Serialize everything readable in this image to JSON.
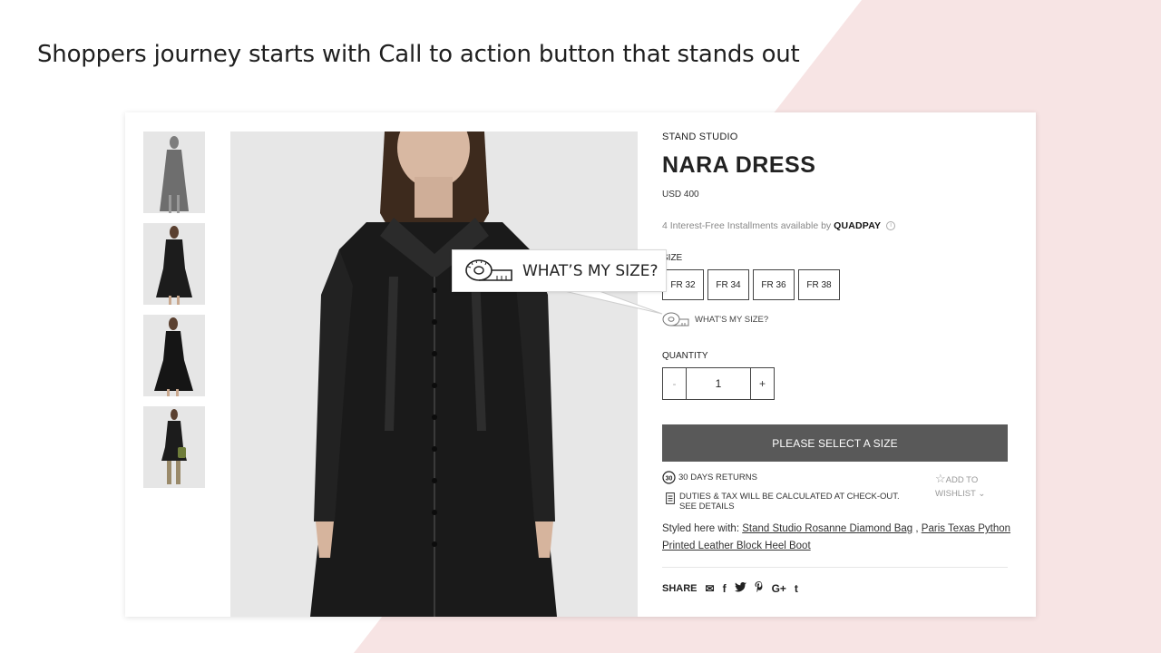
{
  "slide": {
    "title": "Shoppers journey starts with Call to action button that stands out",
    "accent_color": "#f7e4e4"
  },
  "product": {
    "brand": "STAND STUDIO",
    "name": "NARA DRESS",
    "price": "USD 400",
    "installments_text": "4 Interest-Free Installments available by",
    "installments_provider": "QUADPAY",
    "size_label": "SIZE",
    "sizes": [
      "FR 32",
      "FR 34",
      "FR 36",
      "FR 38"
    ],
    "whats_my_size": "WHAT'S MY SIZE?",
    "quantity_label": "QUANTITY",
    "quantity_minus": "-",
    "quantity_value": "1",
    "quantity_plus": "+",
    "cta_label": "PLEASE SELECT A SIZE",
    "returns_badge": "30",
    "returns_label": "30 DAYS RETURNS",
    "duties_line1": "DUTIES & TAX WILL BE CALCULATED AT CHECK-OUT.",
    "duties_line2": "SEE DETAILS",
    "wishlist_line1": "ADD TO",
    "wishlist_line2": "WISHLIST",
    "styled_prefix": "Styled here with:",
    "styled_link1": "Stand Studio Rosanne Diamond Bag",
    "styled_separator": ",",
    "styled_link2": "Paris Texas Python Printed Leather Block Heel Boot",
    "share_label": "SHARE",
    "share_icons": [
      "email-icon",
      "facebook-icon",
      "twitter-icon",
      "pinterest-icon",
      "google-plus-icon",
      "tumblr-icon"
    ],
    "share_glyphs": [
      "✉",
      "f",
      "𝕥",
      "𝓅",
      "G+",
      "t"
    ]
  },
  "callout": {
    "text": "WHAT’S MY SIZE?",
    "icon": "measuring-tape-icon"
  }
}
